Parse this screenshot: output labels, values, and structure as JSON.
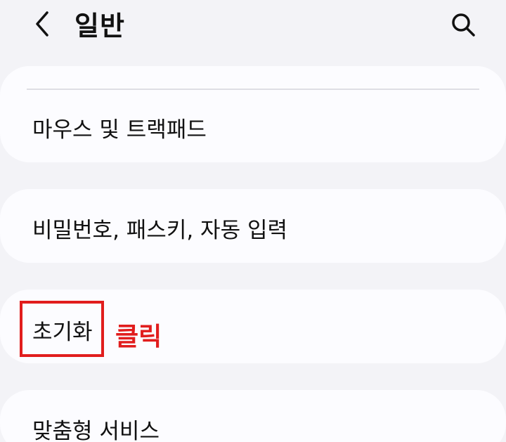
{
  "header": {
    "title": "일반",
    "back_icon": "chevron-left-icon",
    "search_icon": "search-icon"
  },
  "items": [
    {
      "label": "마우스 및 트랙패드"
    },
    {
      "label": "비밀번호, 패스키, 자동 입력"
    },
    {
      "label": "초기화"
    },
    {
      "label": "맞춤형 서비스"
    }
  ],
  "annotation": {
    "text": "클릭",
    "color": "#e11d1d"
  }
}
